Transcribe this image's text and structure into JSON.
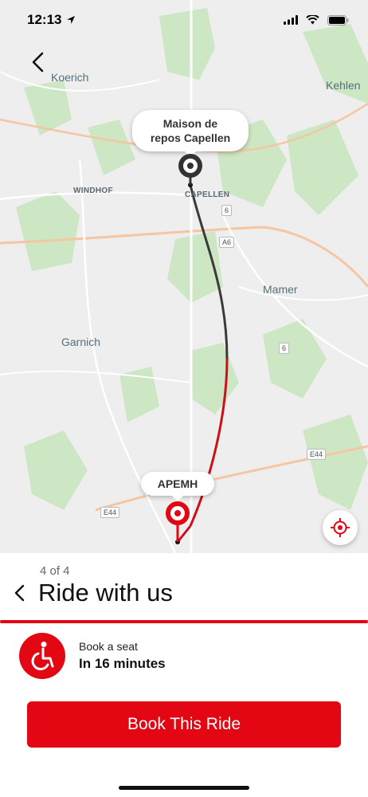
{
  "status_bar": {
    "time": "12:13"
  },
  "map": {
    "labels": {
      "koerich": "Koerich",
      "kehlen": "Kehlen",
      "windhof": "WINDHOF",
      "capellen": "CAPELLEN",
      "mamer": "Mamer",
      "garnich": "Garnich"
    },
    "road_shields": {
      "r6a": "6",
      "r6b": "6",
      "a6": "A6",
      "e44a": "E44",
      "e44b": "E44"
    },
    "origin_label": "Maison de repos Capellen",
    "destination_label": "APEMH"
  },
  "panel": {
    "step": "4 of 4",
    "title": "Ride with us",
    "ride_sub": "Book a seat",
    "ride_time": "In 16 minutes",
    "book_button": "Book This Ride"
  },
  "colors": {
    "accent": "#e30613",
    "route_dark": "#3a3a3a"
  },
  "icons": [
    "location-arrow-icon",
    "signal-icon",
    "wifi-icon",
    "battery-icon",
    "back-arrow-icon",
    "origin-pin-icon",
    "destination-pin-icon",
    "locate-me-icon",
    "wheelchair-icon"
  ]
}
